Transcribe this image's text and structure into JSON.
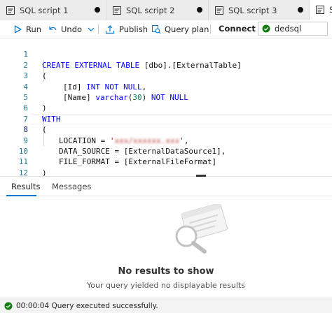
{
  "tabs": [
    {
      "label": "SQL script 1",
      "unsaved": true,
      "active": false
    },
    {
      "label": "SQL script 2",
      "unsaved": true,
      "active": false
    },
    {
      "label": "SQL script 3",
      "unsaved": true,
      "active": false
    },
    {
      "label": "S",
      "active": true
    }
  ],
  "toolbar": {
    "run_label": "Run",
    "undo_label": "Undo",
    "publish_label": "Publish",
    "query_plan_label": "Query plan",
    "connect_to_label": "Connect to",
    "connection_value": "dedsql"
  },
  "editor": {
    "line_numbers": [
      "1",
      "2",
      "3",
      "4",
      "5",
      "6",
      "7",
      "8",
      "9",
      "10",
      "11",
      "12"
    ],
    "lines": {
      "l1_kw": "CREATE EXTERNAL TABLE",
      "l1_rest": " [dbo].[ExternalTable]",
      "l2": "(",
      "l3_name": "[Id] ",
      "l3_type": "INT NOT NULL",
      "l3_end": ",",
      "l4_name": "[Name] ",
      "l4_type": "varchar",
      "l4_open": "(",
      "l4_num": "30",
      "l4_close": ") ",
      "l4_kw": "NOT NULL",
      "l5": ")",
      "l6": "WITH",
      "l7": "(",
      "l8_key": "LOCATION = ",
      "l8_q1": "'",
      "l8_q2": "'",
      "l8_end": ",",
      "l9": "DATA_SOURCE = [ExternalDataSource1],",
      "l10": "FILE_FORMAT = [ExternalFileFormat]",
      "l11": ")"
    },
    "current_line": "8"
  },
  "results": {
    "tab_results": "Results",
    "tab_messages": "Messages",
    "empty_title": "No results to show",
    "empty_subtitle": "Your query yielded no displayable results"
  },
  "status": {
    "message": "00:00:04 Query executed successfully."
  },
  "colors": {
    "accent": "#0078d4",
    "keyword": "#0000ff",
    "number": "#098658",
    "string": "#a31515",
    "success": "#107c10"
  },
  "icons": [
    "sql-script-icon",
    "run-icon",
    "undo-icon",
    "chevron-down-icon",
    "publish-icon",
    "query-plan-icon",
    "database-check-icon",
    "no-results-illustration",
    "success-icon"
  ]
}
